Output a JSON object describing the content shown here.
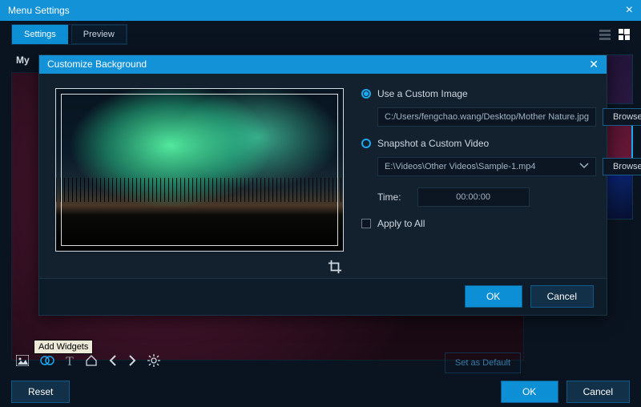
{
  "titlebar": {
    "title": "Menu Settings"
  },
  "tabs": {
    "settings": "Settings",
    "preview": "Preview"
  },
  "main": {
    "my_label": "My"
  },
  "widgets": {
    "tooltip": "Add Widgets",
    "set_default": "Set as Default"
  },
  "footer": {
    "reset": "Reset",
    "ok": "OK",
    "cancel": "Cancel"
  },
  "modal": {
    "title": "Customize Background",
    "use_custom_image": "Use a Custom Image",
    "image_path": "C:/Users/fengchao.wang/Desktop/Mother Nature.jpg",
    "browse": "Browse",
    "snapshot_video": "Snapshot a Custom Video",
    "video_path": "E:\\Videos\\Other Videos\\Sample-1.mp4",
    "time_label": "Time:",
    "time_value": "00:00:00",
    "apply_all": "Apply to All",
    "ok": "OK",
    "cancel": "Cancel"
  }
}
